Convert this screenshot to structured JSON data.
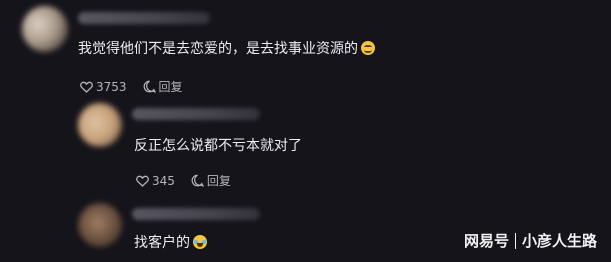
{
  "comments": [
    {
      "text": "我觉得他们不是去恋爱的，是去找事业资源的",
      "emoji": "smile-emoji",
      "likes": "3753",
      "reply_label": "回复"
    },
    {
      "text": "反正怎么说都不亏本就对了",
      "likes": "345",
      "reply_label": "回复"
    },
    {
      "text": "找客户的",
      "emoji": "laugh-cry-emoji"
    }
  ],
  "watermark": {
    "source": "网易号",
    "author": "小彦人生路"
  },
  "icons": {
    "like": "heart-icon",
    "reply": "comment-bubble-icon"
  },
  "colors": {
    "background": "#15141b",
    "text": "#ededf0",
    "muted": "#b5b4bc"
  }
}
